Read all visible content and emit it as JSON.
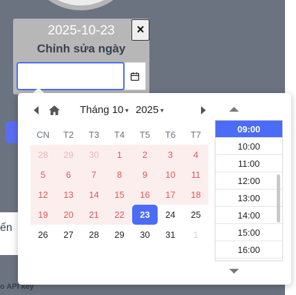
{
  "dialog": {
    "date_value": "2025-10-23",
    "heading": "Chỉnh sửa ngày",
    "close_label": "×",
    "input_value": ""
  },
  "background": {
    "partial_text": "ến",
    "partial_api_text": "o API key"
  },
  "picker": {
    "month_label": "Tháng 10",
    "year_label": "2025",
    "weekdays": [
      "CN",
      "T2",
      "T3",
      "T4",
      "T5",
      "T6",
      "T7"
    ],
    "weeks": [
      [
        {
          "d": "28",
          "s": "pink-muted"
        },
        {
          "d": "29",
          "s": "pink-muted"
        },
        {
          "d": "30",
          "s": "pink-muted"
        },
        {
          "d": "1",
          "s": "pink"
        },
        {
          "d": "2",
          "s": "pink"
        },
        {
          "d": "3",
          "s": "pink"
        },
        {
          "d": "4",
          "s": "pink"
        }
      ],
      [
        {
          "d": "5",
          "s": "pink"
        },
        {
          "d": "6",
          "s": "pink"
        },
        {
          "d": "7",
          "s": "pink"
        },
        {
          "d": "8",
          "s": "pink"
        },
        {
          "d": "9",
          "s": "pink"
        },
        {
          "d": "10",
          "s": "pink"
        },
        {
          "d": "11",
          "s": "pink"
        }
      ],
      [
        {
          "d": "12",
          "s": "pink"
        },
        {
          "d": "13",
          "s": "pink"
        },
        {
          "d": "14",
          "s": "pink"
        },
        {
          "d": "15",
          "s": "pink"
        },
        {
          "d": "16",
          "s": "pink"
        },
        {
          "d": "17",
          "s": "pink"
        },
        {
          "d": "18",
          "s": "pink"
        }
      ],
      [
        {
          "d": "19",
          "s": "pink"
        },
        {
          "d": "20",
          "s": "pink"
        },
        {
          "d": "21",
          "s": "pink"
        },
        {
          "d": "22",
          "s": "pink"
        },
        {
          "d": "23",
          "s": "selected"
        },
        {
          "d": "24",
          "s": "normal"
        },
        {
          "d": "25",
          "s": "normal"
        }
      ],
      [
        {
          "d": "26",
          "s": "normal"
        },
        {
          "d": "27",
          "s": "normal"
        },
        {
          "d": "28",
          "s": "normal"
        },
        {
          "d": "29",
          "s": "normal"
        },
        {
          "d": "30",
          "s": "normal"
        },
        {
          "d": "31",
          "s": "normal"
        },
        {
          "d": "1",
          "s": "muted"
        }
      ]
    ],
    "times": [
      "09:00",
      "10:00",
      "11:00",
      "12:00",
      "13:00",
      "14:00",
      "15:00",
      "16:00"
    ],
    "selected_time": "09:00"
  },
  "icons": {
    "prev": "chevron-left-icon",
    "home": "home-icon",
    "next": "chevron-right-icon",
    "calendar": "calendar-icon",
    "time_up": "arrow-up-icon",
    "time_down": "arrow-down-icon"
  },
  "colors": {
    "accent": "#4a6cf7",
    "range_bg": "#fdeeee",
    "range_text": "#e05757"
  }
}
